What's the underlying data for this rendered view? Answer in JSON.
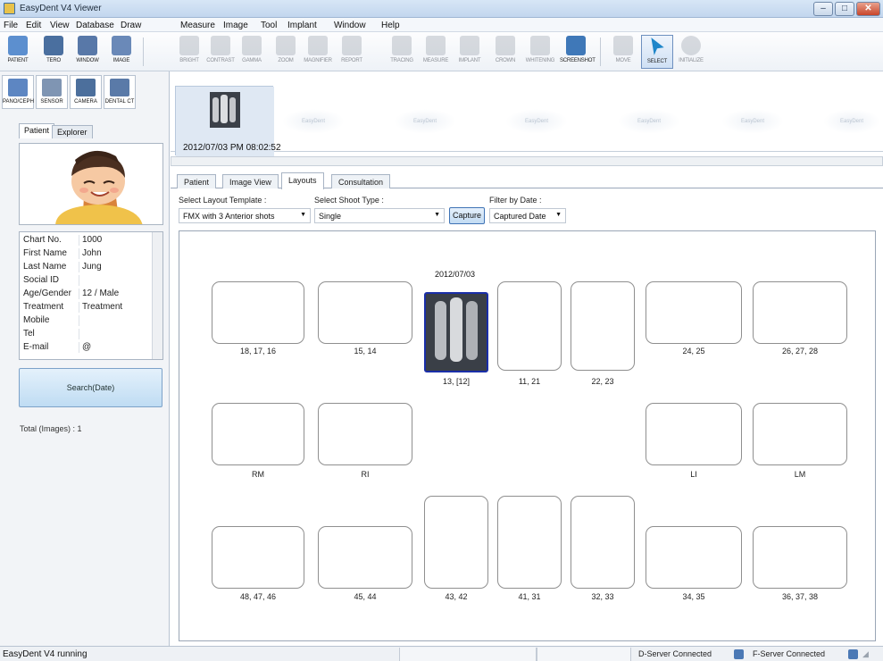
{
  "window": {
    "title": "EasyDent V4 Viewer",
    "min": "–",
    "max": "□",
    "close": "✕"
  },
  "menus": [
    "File",
    "Edit",
    "View",
    "Database",
    "Draw",
    "Measure",
    "Image",
    "Tool",
    "Implant",
    "Window",
    "Help"
  ],
  "toolbar": {
    "main": [
      {
        "label": "PATIENT",
        "icon": "patient-icon",
        "color": "#5c8fcf"
      },
      {
        "label": "TERO",
        "icon": "tero-icon",
        "color": "#4a6f9f"
      },
      {
        "label": "WINDOW",
        "icon": "window-icon",
        "color": "#5878a8"
      },
      {
        "label": "IMAGE",
        "icon": "image-icon",
        "color": "#6a89b8"
      }
    ],
    "tools": [
      {
        "label": "BRIGHT",
        "icon": "bright-icon"
      },
      {
        "label": "CONTRAST",
        "icon": "contrast-icon"
      },
      {
        "label": "GAMMA",
        "icon": "gamma-icon"
      },
      {
        "label": "ZOOM",
        "icon": "zoom-icon"
      },
      {
        "label": "MAGNIFIER",
        "icon": "magnifier-icon"
      },
      {
        "label": "REPORT",
        "icon": "report-icon"
      },
      {
        "label": "TRACING",
        "icon": "tracing-icon"
      },
      {
        "label": "MEASURE",
        "icon": "measure-icon"
      },
      {
        "label": "IMPLANT",
        "icon": "implant-icon"
      },
      {
        "label": "CROWN",
        "icon": "crown-icon"
      },
      {
        "label": "WHITENING",
        "icon": "whitening-icon"
      },
      {
        "label": "SCREENSHOT",
        "icon": "screenshot-icon"
      }
    ],
    "nav": [
      {
        "label": "MOVE",
        "icon": "move-icon"
      },
      {
        "label": "SELECT",
        "icon": "select-icon"
      },
      {
        "label": "INITIALIZE",
        "icon": "initialize-icon"
      }
    ]
  },
  "sidebar": {
    "tools": [
      {
        "label": "PANO/CEPH",
        "icon": "pano-ceph-icon"
      },
      {
        "label": "SENSOR",
        "icon": "sensor-icon"
      },
      {
        "label": "CAMERA",
        "icon": "camera-icon"
      },
      {
        "label": "DENTAL CT",
        "icon": "dental-ct-icon"
      }
    ],
    "tabs": [
      "Patient",
      "Explorer"
    ],
    "patient": [
      {
        "key": "Chart No.",
        "value": "1000"
      },
      {
        "key": "First Name",
        "value": "John"
      },
      {
        "key": "Last Name",
        "value": "Jung"
      },
      {
        "key": "Social ID",
        "value": ""
      },
      {
        "key": "Age/Gender",
        "value": "12 / Male"
      },
      {
        "key": "Treatment",
        "value": "Treatment"
      },
      {
        "key": "Mobile",
        "value": ""
      },
      {
        "key": "Tel",
        "value": ""
      },
      {
        "key": "E-mail",
        "value": "@"
      }
    ],
    "search_label": "Search(Date)",
    "total_label": "Total (Images) : 1"
  },
  "thumbs": {
    "date": "2012/07/03 PM 08:02:52",
    "placeholder": "EasyDent"
  },
  "content_tabs": [
    "Patient",
    "Image View",
    "Layouts",
    "Consultation"
  ],
  "filters": {
    "template_label": "Select Layout Template :",
    "template_value": "FMX with 3 Anterior shots",
    "shot_label": "Select Shoot Type :",
    "shot_value": "Single",
    "capture_label": "Capture",
    "date_label": "Filter by Date :",
    "date_value": "Captured Date"
  },
  "layout": {
    "filled_date": "2012/07/03",
    "slots": [
      "18, 17, 16",
      "15, 14",
      "13, [12]",
      "11, 21",
      "22, 23",
      "24, 25",
      "26, 27, 28",
      "RM",
      "RI",
      "LI",
      "LM",
      "48, 47, 46",
      "45, 44",
      "43, 42",
      "41, 31",
      "32, 33",
      "34, 35",
      "36, 37, 38"
    ]
  },
  "status": {
    "text": "EasyDent V4 running",
    "d_server": "D-Server Connected",
    "f_server": "F-Server Connected"
  }
}
